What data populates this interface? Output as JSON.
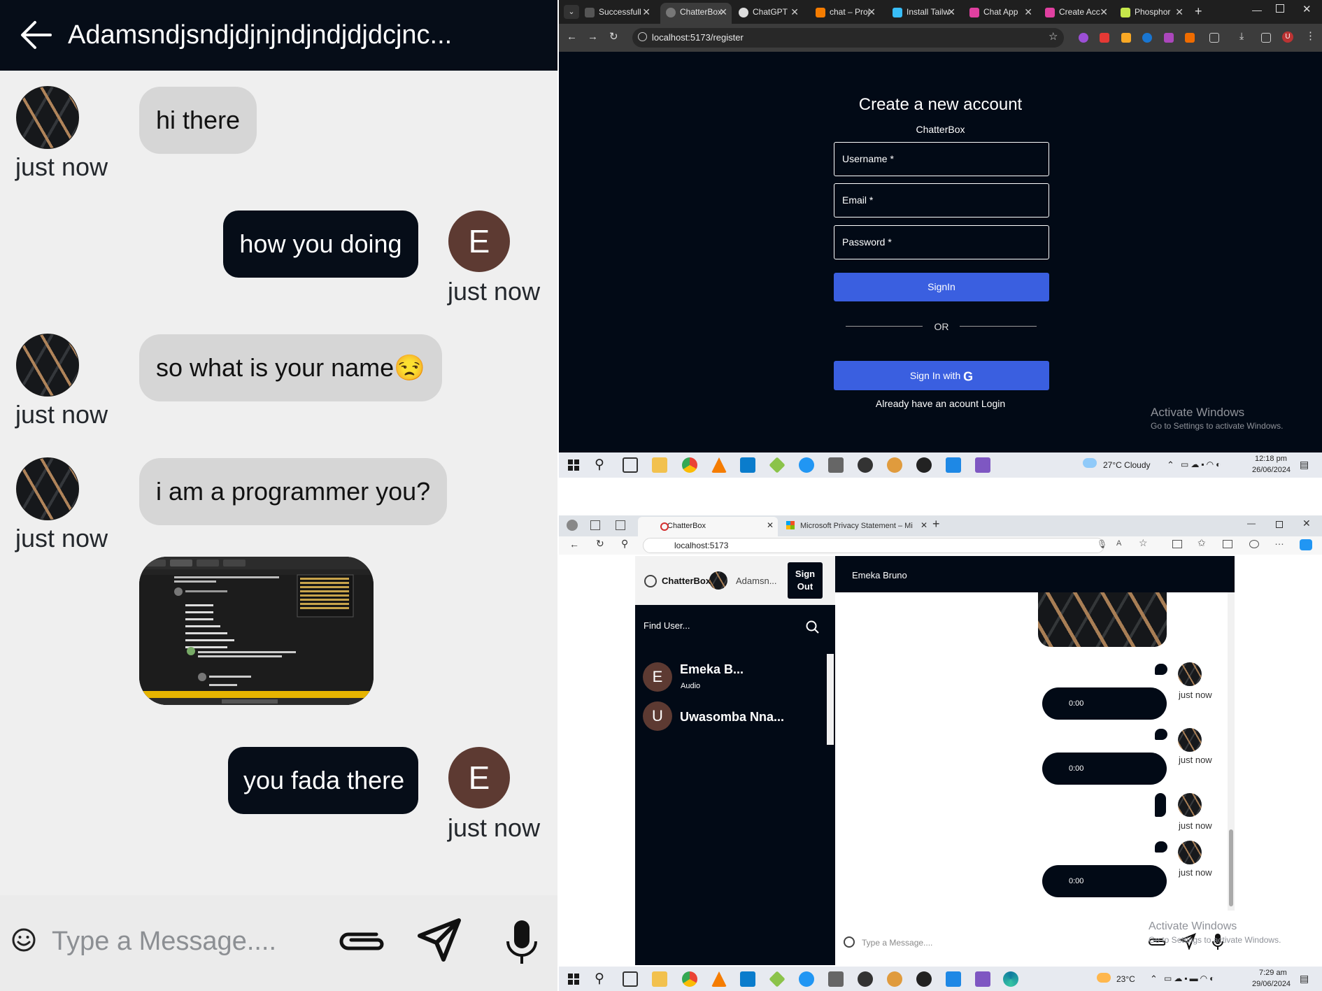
{
  "mobile": {
    "title": "Adamsndjsndjdjnjndjndjdjdcjnc...",
    "messages": [
      {
        "side": "in",
        "text": "hi there",
        "time": "just now"
      },
      {
        "side": "out",
        "text": "how you doing",
        "avatar": "E",
        "time": "just now"
      },
      {
        "side": "in",
        "text": "so what is your name😒",
        "time": "just now"
      },
      {
        "side": "in",
        "text": "i am a programmer you?",
        "time": "just now"
      },
      {
        "side": "in",
        "type": "image"
      },
      {
        "side": "out",
        "text": "you fada there",
        "avatar": "E",
        "time": "just now"
      }
    ],
    "input_placeholder": "Type a Message....",
    "icons": [
      "back-arrow-icon",
      "emoji-icon",
      "paperclip-icon",
      "send-icon",
      "mic-icon"
    ]
  },
  "chrome": {
    "tabs": [
      {
        "label": "Successfull"
      },
      {
        "label": "ChatterBox",
        "active": true
      },
      {
        "label": "ChatGPT"
      },
      {
        "label": "chat – Proj"
      },
      {
        "label": "Install Tailw"
      },
      {
        "label": "Chat App"
      },
      {
        "label": "Create Acc"
      },
      {
        "label": "Phosphor"
      }
    ],
    "url": "localhost:5173/register",
    "form": {
      "title": "Create a new account",
      "subtitle": "ChatterBox",
      "username_label": "Username *",
      "email_label": "Email *",
      "password_label": "Password *",
      "signin_label": "SignIn",
      "or_label": "OR",
      "google_label": "Sign In with",
      "login_text": "Already have an acount Login"
    },
    "activate": {
      "title": "Activate Windows",
      "subtitle": "Go to Settings to activate Windows."
    },
    "taskbar": {
      "weather": "27°C  Cloudy",
      "time": "12:18 pm",
      "date": "26/06/2024"
    }
  },
  "edge": {
    "tabs": [
      {
        "label": "ChatterBox",
        "active": true
      },
      {
        "label": "Microsoft Privacy Statement – Mi"
      }
    ],
    "url": "localhost:5173",
    "app": {
      "brand": "ChatterBox",
      "user_short": "Adamsn...",
      "signout_label": "Sign Out",
      "search_placeholder": "Find User...",
      "users": [
        {
          "initial": "E",
          "name": "Emeka B...",
          "sub": "Audio"
        },
        {
          "initial": "U",
          "name": "Uwasomba Nna...",
          "sub": ""
        }
      ],
      "peer_name": "Emeka Bruno",
      "audio_messages": [
        {
          "duration": "0:00",
          "time": "just now"
        },
        {
          "duration": "0:00",
          "time": "just now"
        },
        {
          "duration": "",
          "time": "just now"
        },
        {
          "duration": "0:00",
          "time": "just now"
        }
      ],
      "input_placeholder": "Type a Message...."
    },
    "activate": {
      "title": "Activate Windows",
      "subtitle": "Go to Settings to activate Windows."
    },
    "taskbar": {
      "weather": "23°C",
      "time": "7:29 am",
      "date": "29/06/2024"
    }
  }
}
